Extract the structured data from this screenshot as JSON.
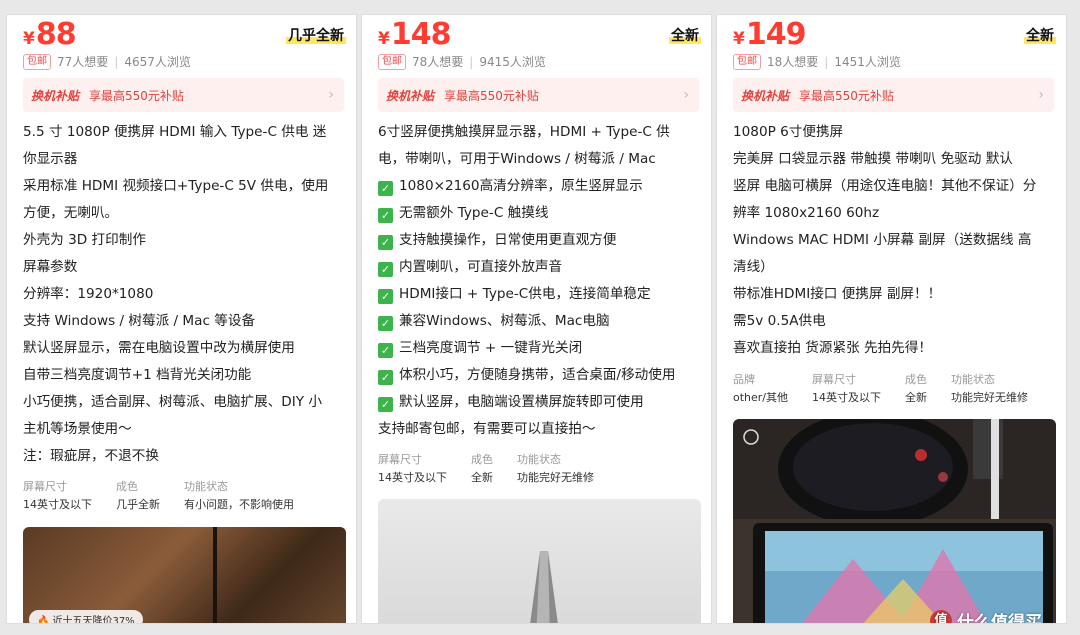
{
  "currency_symbol": "¥",
  "cards": [
    {
      "price": "88",
      "condition": "几乎全新",
      "badge": "包邮",
      "wants": "77人想要",
      "views": "4657人浏览",
      "subsidy_tag": "换机补贴",
      "subsidy_text": "享最高550元补贴",
      "description": [
        "5.5 寸 1080P 便携屏 HDMI 输入 Type-C 供电 迷",
        "你显示器",
        "采用标准 HDMI 视频接口+Type-C 5V 供电，使用",
        "方便，无喇叭。",
        "外壳为 3D 打印制作",
        "屏幕参数",
        "分辨率：1920*1080",
        "支持 Windows / 树莓派 / Mac 等设备",
        "默认竖屏显示，需在电脑设置中改为横屏使用",
        "自带三档亮度调节+1 档背光关闭功能",
        "小巧便携，适合副屏、树莓派、电脑扩展、DIY 小",
        "主机等场景使用～",
        "注：瑕疵屏，不退不换"
      ],
      "attributes": [
        {
          "key": "屏幕尺寸",
          "value": "14英寸及以下"
        },
        {
          "key": "成色",
          "value": "几乎全新"
        },
        {
          "key": "功能状态",
          "value": "有小问题，不影响使用"
        }
      ],
      "price_drop": "近十五天降价37%"
    },
    {
      "price": "148",
      "condition": "全新",
      "badge": "包邮",
      "wants": "78人想要",
      "views": "9415人浏览",
      "subsidy_tag": "换机补贴",
      "subsidy_text": "享最高550元补贴",
      "description_plain": [
        "6寸竖屏便携触摸屏显示器，HDMI + Type-C 供",
        "电，带喇叭，可用于Windows / 树莓派 / Mac"
      ],
      "description_checks": [
        "1080×2160高清分辨率，原生竖屏显示",
        "无需额外 Type-C 触摸线",
        "支持触摸操作，日常使用更直观方便",
        "内置喇叭，可直接外放声音",
        "HDMI接口 + Type-C供电，连接简单稳定",
        "兼容Windows、树莓派、Mac电脑",
        "三档亮度调节 + 一键背光关闭",
        "体积小巧，方便随身携带，适合桌面/移动使用",
        "默认竖屏，电脑端设置横屏旋转即可使用"
      ],
      "description_tail": "支持邮寄包邮，有需要可以直接拍～",
      "attributes": [
        {
          "key": "屏幕尺寸",
          "value": "14英寸及以下"
        },
        {
          "key": "成色",
          "value": "全新"
        },
        {
          "key": "功能状态",
          "value": "功能完好无维修"
        }
      ]
    },
    {
      "price": "149",
      "condition": "全新",
      "badge": "包邮",
      "wants": "18人想要",
      "views": "1451人浏览",
      "subsidy_tag": "换机补贴",
      "subsidy_text": "享最高550元补贴",
      "description": [
        "1080P 6寸便携屏",
        "完美屏 口袋显示器 带触摸  带喇叭 免驱动  默认",
        "竖屏 电脑可横屏（用途仅连电脑！其他不保证）分",
        "辨率 1080x2160  60hz",
        " Windows MAC HDMI 小屏幕 副屏（送数据线 高",
        "清线）",
        "带标准HDMI接口 便携屏 副屏！！",
        "需5v 0.5A供电",
        "喜欢直接拍 货源紧张  先拍先得！"
      ],
      "attributes": [
        {
          "key": "品牌",
          "value": "other/其他"
        },
        {
          "key": "屏幕尺寸",
          "value": "14英寸及以下"
        },
        {
          "key": "成色",
          "value": "全新"
        },
        {
          "key": "功能状态",
          "value": "功能完好无维修"
        }
      ]
    }
  ],
  "watermark": "什么值得买",
  "watermark_icon_text": "值",
  "colors": {
    "price": "#ff3c32",
    "check": "#3cb44b",
    "subsidy_bg": "#fdf0ef"
  }
}
